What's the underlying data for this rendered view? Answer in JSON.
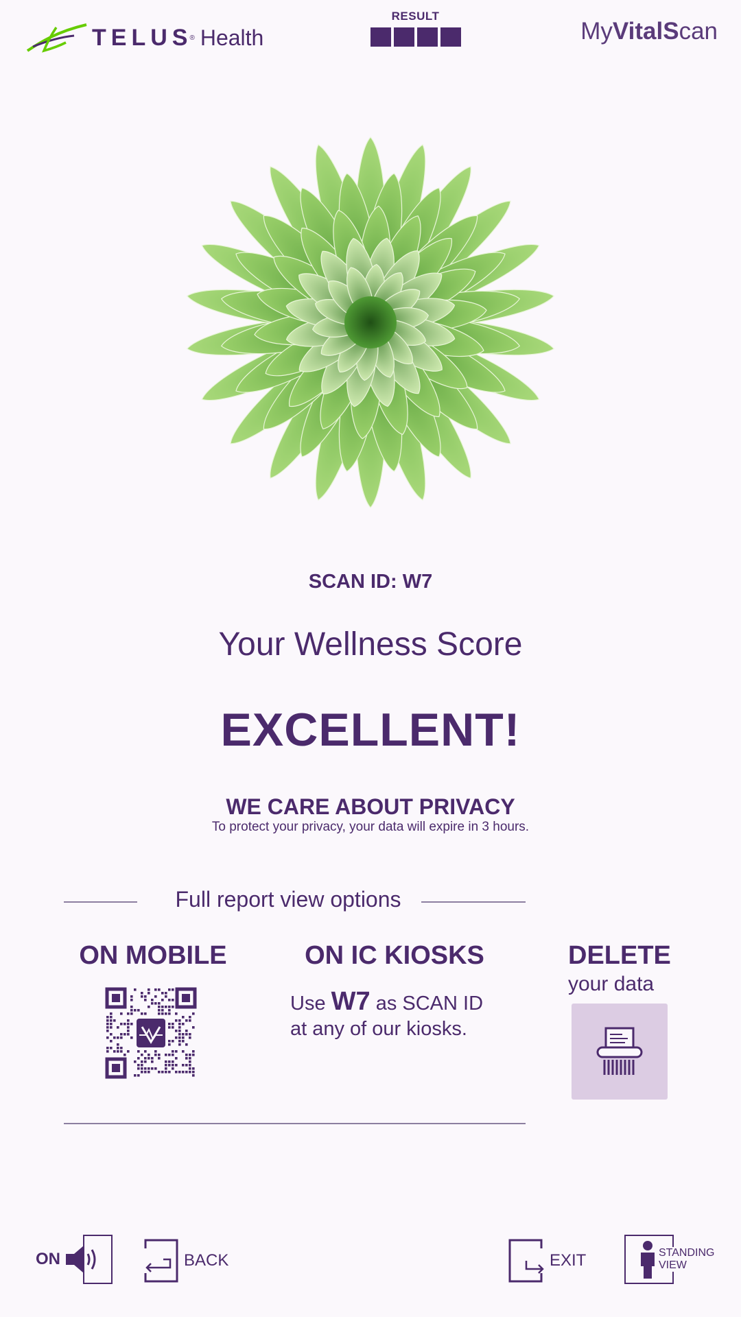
{
  "header": {
    "brand": "TELUS",
    "brand_suffix": "Health",
    "progress_label": "RESULT",
    "progress_steps": 4,
    "app_name_prefix": "My",
    "app_name_bold": "VitalS",
    "app_name_suffix": "can"
  },
  "result": {
    "scan_id_label": "SCAN ID: W7",
    "score_title": "Your Wellness Score",
    "score_value": "EXCELLENT!",
    "privacy_title": "WE CARE ABOUT PRIVACY",
    "privacy_text": "To protect your privacy, your data will expire in 3 hours."
  },
  "report": {
    "section_label": "Full report view options",
    "mobile_title": "ON MOBILE",
    "kiosk_title": "ON IC KIOSKS",
    "kiosk_use": "Use",
    "kiosk_code": "W7",
    "kiosk_as": "as SCAN ID",
    "kiosk_line2": "at any of our kiosks.",
    "delete_title": "DELETE",
    "delete_sub": "your data"
  },
  "footer": {
    "sound_label": "ON",
    "back_label": "BACK",
    "exit_label": "EXIT",
    "standing_line1": "STANDING",
    "standing_line2": "VIEW"
  },
  "colors": {
    "primary": "#4b2a6c",
    "background": "#fbf8fc",
    "delete_bg": "#dccce3",
    "logo_green": "#66cc00"
  },
  "icons": {
    "brand": "telus-leaf-icon",
    "qr": "qr-code-icon",
    "delete": "shredder-icon",
    "sound": "speaker-icon",
    "back": "back-door-icon",
    "exit": "exit-door-icon",
    "standing": "person-icon"
  }
}
